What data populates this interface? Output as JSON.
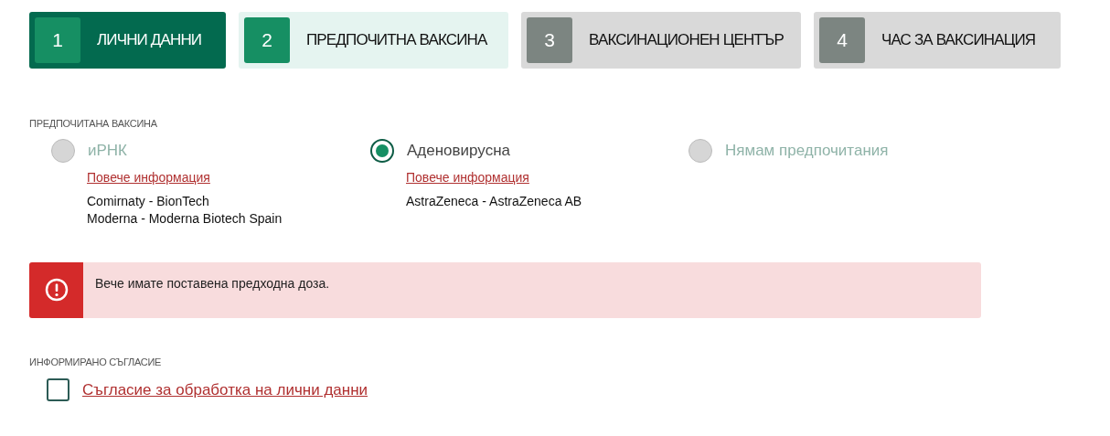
{
  "steps": [
    {
      "number": "1",
      "label": "ЛИЧНИ ДАННИ",
      "completed": true,
      "selected": false
    },
    {
      "number": "2",
      "label": "ПРЕДПОЧИТНА ВАКСИНА",
      "completed": false,
      "selected": true
    },
    {
      "number": "3",
      "label": "ВАКСИНАЦИОНЕН ЦЕНТЪР",
      "completed": false,
      "selected": false
    },
    {
      "number": "4",
      "label": "ЧАС ЗА ВАКСИНАЦИЯ",
      "completed": false,
      "selected": false
    }
  ],
  "vaccine_section": {
    "title": "ПРЕДПОЧИТАНА ВАКСИНА",
    "options": [
      {
        "label": "иРНК",
        "selected": false,
        "disabled": true,
        "link": "Повече информация",
        "vaccines": [
          "Comirnaty - BionTech",
          "Moderna - Moderna Biotech Spain"
        ]
      },
      {
        "label": "Аденовирусна",
        "selected": true,
        "disabled": false,
        "link": "Повече информация",
        "vaccines": [
          "AstraZeneca - AstraZeneca AB"
        ]
      },
      {
        "label": "Нямам предпочитания",
        "selected": false,
        "disabled": true
      }
    ]
  },
  "alert": {
    "message": "Вече имате поставена предходна доза."
  },
  "consent": {
    "title": "ИНФОРМИРАНО СЪГЛАСИЕ",
    "checkbox": {
      "label": "Съгласие за обработка на лични данни",
      "checked": false
    }
  }
}
